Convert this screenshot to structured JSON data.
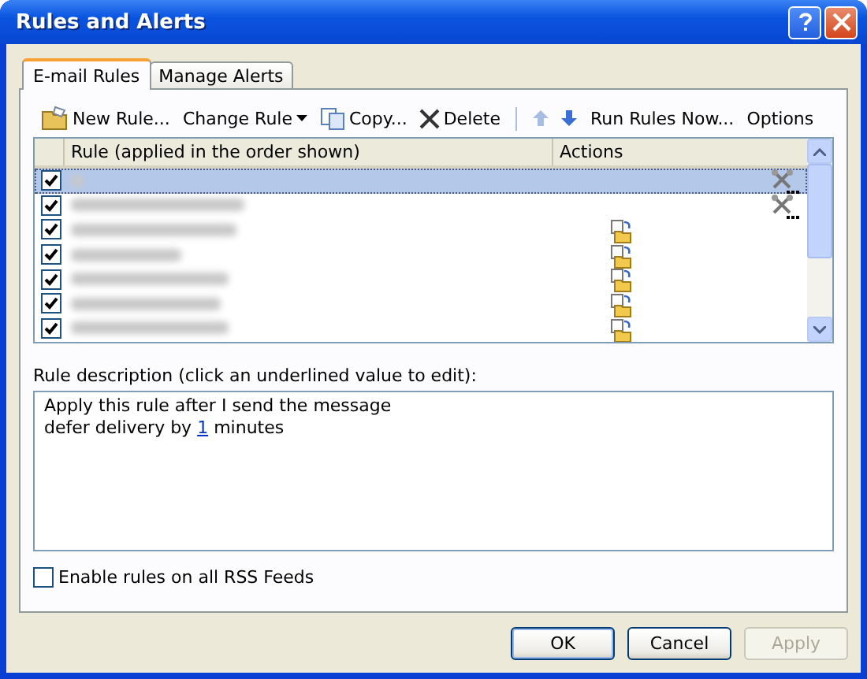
{
  "window": {
    "title": "Rules and Alerts"
  },
  "tabs": [
    {
      "label": "E-mail Rules",
      "selected": true
    },
    {
      "label": "Manage Alerts",
      "selected": false
    }
  ],
  "toolbar": [
    {
      "kind": "new",
      "label": "New Rule..."
    },
    {
      "kind": "dropdown",
      "label": "Change Rule"
    },
    {
      "kind": "copy",
      "label": "Copy..."
    },
    {
      "kind": "delete",
      "label": "Delete"
    },
    {
      "kind": "separator"
    },
    {
      "kind": "up"
    },
    {
      "kind": "down"
    },
    {
      "kind": "plain",
      "label": "Run Rules Now..."
    },
    {
      "kind": "plain",
      "label": "Options"
    }
  ],
  "rules_list": {
    "columns": [
      "Rule (applied in the order shown)",
      "Actions"
    ],
    "rows": [
      {
        "checked": true,
        "selected": true,
        "kind": "custom"
      },
      {
        "checked": true,
        "selected": false,
        "kind": "custom"
      },
      {
        "checked": true,
        "selected": false,
        "kind": "move"
      },
      {
        "checked": true,
        "selected": false,
        "kind": "move"
      },
      {
        "checked": true,
        "selected": false,
        "kind": "move"
      },
      {
        "checked": true,
        "selected": false,
        "kind": "move"
      },
      {
        "checked": true,
        "selected": false,
        "kind": "move"
      }
    ]
  },
  "description": {
    "label": "Rule description (click an underlined value to edit):",
    "lines": [
      [
        {
          "text": "Apply this rule after I send the message",
          "link": false
        }
      ],
      [
        {
          "text": "defer delivery by ",
          "link": false
        },
        {
          "text": "1",
          "link": true
        },
        {
          "text": " minutes",
          "link": false
        }
      ]
    ]
  },
  "rss_checkbox": {
    "label": "Enable rules on all RSS Feeds",
    "checked": false
  },
  "buttons": [
    {
      "label": "OK",
      "disabled": false,
      "default": true
    },
    {
      "label": "Cancel",
      "disabled": false,
      "default": false
    },
    {
      "label": "Apply",
      "disabled": true,
      "default": false
    }
  ]
}
